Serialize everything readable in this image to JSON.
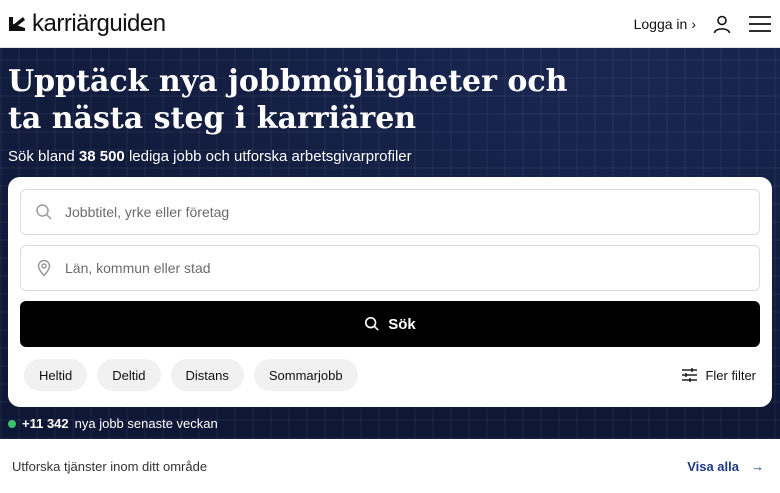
{
  "header": {
    "logo_text": "karriärguiden",
    "login_label": "Logga in",
    "login_chevron": "›"
  },
  "hero": {
    "title": "Upptäck nya jobbmöjligheter och ta nästa steg i karriären",
    "subtitle_prefix": "Sök bland",
    "subtitle_count": "38 500",
    "subtitle_suffix": "lediga jobb och utforska arbetsgivarprofiler"
  },
  "search": {
    "job_placeholder": "Jobbtitel, yrke eller företag",
    "location_placeholder": "Län, kommun eller stad",
    "button_label": "Sök",
    "filters": [
      "Heltid",
      "Deltid",
      "Distans",
      "Sommarjobb"
    ],
    "more_filters_label": "Fler filter"
  },
  "new_jobs": {
    "count": "+11 342",
    "text": "nya jobb senaste veckan"
  },
  "explore": {
    "label": "Utforska tjänster inom ditt område",
    "show_all_label": "Visa alla",
    "arrow": "→"
  },
  "colors": {
    "hero_bg": "#0f1a39",
    "button_bg": "#000000",
    "status_dot": "#3cc36a",
    "link": "#1c3a8a"
  },
  "icons": {
    "logo": "logo-mark-icon",
    "user": "user-icon",
    "menu": "hamburger-menu-icon",
    "search": "search-icon",
    "location": "location-pin-icon",
    "filters": "sliders-icon"
  }
}
